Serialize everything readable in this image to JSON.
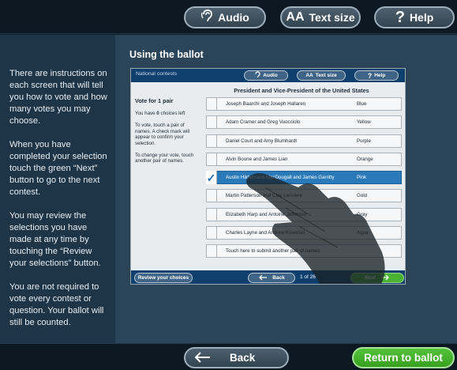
{
  "topbar": {
    "audio_label": "Audio",
    "audio_icon": "ear-icon",
    "textsize_icon": "AA",
    "textsize_label": "Text size",
    "help_icon": "?",
    "help_label": "Help"
  },
  "sidebar": {
    "paragraphs": [
      "There are instructions on each screen that will tell you how to vote and how many votes you may choose.",
      "When you have completed your selection touch the green “Next” button to go to the next contest.",
      "You may review the selections you have made at any time by touching the “Review your selections” button.",
      "You are not required to vote every contest or question.  Your ballot will still be counted."
    ]
  },
  "main": {
    "title": "Using the ballot"
  },
  "ballot": {
    "contest_label": "National contests",
    "audio_label": "Audio",
    "textsize_icon": "AA",
    "textsize_label": "Text size",
    "help_icon": "?",
    "help_label": "Help",
    "heading": "President and Vice-President of the United States",
    "vote_for": "Vote for 1 pair",
    "choices_left": {
      "prefix": "You have ",
      "count": "0",
      "suffix": " choices left"
    },
    "instruction_1": "To vote, touch a pair of names. A check mark will appear to confirm your selection.",
    "instruction_2": "To change your vote, touch another pair of names.",
    "candidates": [
      {
        "names": "Joseph Baarchi and Joseph Hallaren",
        "party": "Blue",
        "selected": false
      },
      {
        "names": "Adam Cramer and Greg Vuocciolo",
        "party": "Yellow",
        "selected": false
      },
      {
        "names": "Daniel Court and Amy Blumhardt",
        "party": "Purple",
        "selected": false
      },
      {
        "names": "Alvin Boone and James Lian",
        "party": "Orange",
        "selected": false
      },
      {
        "names": "Austin Hildebrand-MacDougall and James Garritty",
        "party": "Pink",
        "selected": true
      },
      {
        "names": "Martin Patterson and Clay Lariviere",
        "party": "Gold",
        "selected": false
      },
      {
        "names": "Elizabeth Harp and Antoine Jefferson",
        "party": "Gray",
        "selected": false
      },
      {
        "names": "Charles Layne and Andrew Kowalski",
        "party": "Aqua",
        "selected": false
      },
      {
        "names": "Touch here to submit another pair of names",
        "party": "",
        "selected": false
      }
    ],
    "check_mark": "✓",
    "review_label": "Review your choices",
    "back_label": "Back",
    "page_label": "1 of 26",
    "next_label": "Next"
  },
  "bottombar": {
    "back_label": "Back",
    "return_label": "Return to ballot"
  },
  "colors": {
    "accent_green": "#49b232",
    "selected_blue": "#2a79b9",
    "nav_dark": "#0c1822"
  }
}
